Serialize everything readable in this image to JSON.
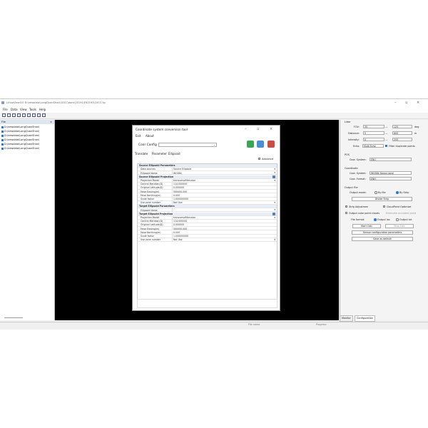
{
  "app": {
    "title": "LiHuaView3.0 D:\\newdata\\LongQuanShan\\10CC\\docs\\20191\\F82195\\10CC.lip",
    "menu": [
      "File",
      "Data",
      "View",
      "Tools",
      "Help"
    ]
  },
  "file_panel": {
    "header": "File",
    "items": [
      "D:\\newdata\\LongQuanShan\\",
      "D:\\newdata\\LongQuanShan\\",
      "D:\\newdata\\LongQuanShan\\",
      "D:\\newdata\\LongQuanShan\\",
      "D:\\newdata\\LongQuanShan\\",
      "D:\\newdata\\LongQuanShan\\"
    ]
  },
  "dialog": {
    "title": "Coordinate system conversion tool",
    "menu": [
      "Exit",
      "About"
    ],
    "coor_config_label": "Coor Config",
    "tabs": [
      "Translate",
      "Parameter",
      "Ellipsoid"
    ],
    "advance_label": "Advance",
    "rows": [
      {
        "type": "section",
        "label": "Source Ellipsoid Parameters"
      },
      {
        "label": "Data sources",
        "value": "Source Ellipsoid",
        "dropdown": true
      },
      {
        "label": "Ellipsoid Name",
        "value": "WGS84",
        "dropdown": true
      },
      {
        "type": "section",
        "label": "Source Ellipsoid Projection",
        "icon": true
      },
      {
        "label": "Projection Model",
        "value": "transverseMercator",
        "dropdown": true
      },
      {
        "label": "Central Meridian(D)",
        "value": "114.000000"
      },
      {
        "label": "Original Latitude(D)",
        "value": "0.000000"
      },
      {
        "label": "False Easting(m)",
        "value": "500000.000"
      },
      {
        "label": "False Northing(m)",
        "value": "0.000"
      },
      {
        "label": "Scale factor",
        "value": "1.000000000"
      },
      {
        "label": "Use zone number",
        "value": "Not Use",
        "dropdown": true
      },
      {
        "type": "section",
        "label": "Target Ellipsoid Parameters"
      },
      {
        "label": "Ellipsoid Name",
        "value": "",
        "dropdown": true
      },
      {
        "type": "section",
        "label": "Target Ellipsoid Projection",
        "icon": true
      },
      {
        "label": "Projection Model",
        "value": "transverseMercator",
        "dropdown": true
      },
      {
        "label": "Central Meridian(D)",
        "value": "114.000000"
      },
      {
        "label": "Original Latitude(D)",
        "value": "0.000000"
      },
      {
        "label": "False Easting(m)",
        "value": "500000.000"
      },
      {
        "label": "False Northing(m)",
        "value": "0.000"
      },
      {
        "label": "Scale factor",
        "value": "1.000000000"
      },
      {
        "label": "Use zone number",
        "value": "Not Use",
        "dropdown": true
      }
    ]
  },
  "right_panel": {
    "lidar_label": "Lidar",
    "fov_label": "FOV:",
    "fov_min": "35",
    "fov_max": "125",
    "fov_unit": "deg",
    "distance_label": "Distance:",
    "distance_min": "5",
    "distance_max": "600",
    "distance_unit": "m",
    "intensity_label": "Intensity:",
    "intensity_min": "0",
    "intensity_max": "255",
    "dash": "—",
    "echo_label": "Echo:",
    "echo_value": "Multi Echo",
    "filter_label": "Filter duplicate points",
    "pos_label": "POS",
    "coor_system_label": "Coor. System:",
    "coor_system_value": "ENU",
    "coordinate_label": "Coordinate",
    "coor_system2_label": "Coor. System:",
    "coor_system2_value": "WGS84 Gauss Local",
    "coor_format_label": "Coor. Format:",
    "coor_format_value": "ENH",
    "output_file_label": "Output File",
    "output_mode_label": "Output mode:",
    "by_file_label": "By file",
    "by_strip_label": "By Strip",
    "divide_strip_label": "Divide Strip",
    "strip_adjustment_label": "Strip Adjustmen",
    "cloudpoint_label": "CloudPoint Optimize",
    "output_color_label": "Output color point clouds",
    "eliminate_label": "Eliminate occluded point",
    "file_format_label": "File format:",
    "output_las_label": "Output las",
    "output_txt_label": "Output txt",
    "start_calc_label": "Start Calc",
    "stop_calc_label": "Stop Calc",
    "sensor_config_label": "Sensor configuration parameters",
    "save_default_label": "Save as default"
  },
  "bottom_tabs": [
    "Monitor",
    "Configuration"
  ],
  "status": {
    "file_name": "File name",
    "progress": "Progress"
  }
}
